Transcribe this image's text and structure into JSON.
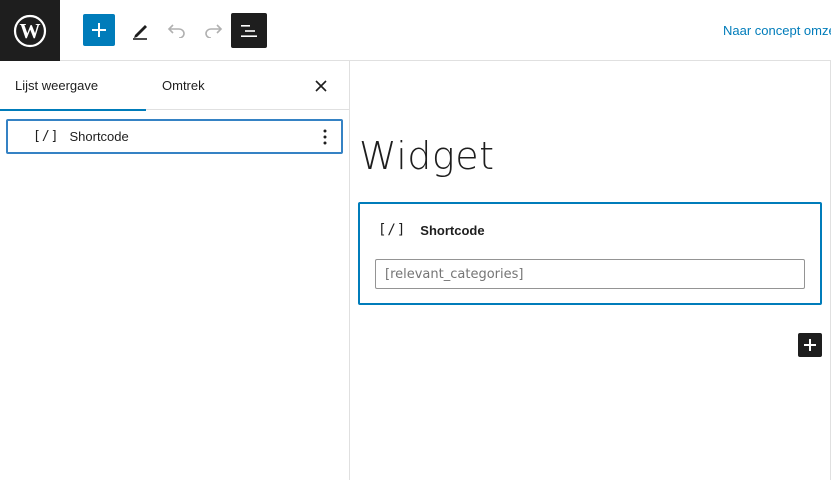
{
  "toolbar": {
    "logo_icon": "wordpress-icon",
    "add_icon": "plus-icon",
    "tools_icon": "pencil-icon",
    "undo_icon": "undo-icon",
    "redo_icon": "redo-icon",
    "list_view_icon": "list-view-icon",
    "draft_link": "Naar concept omze"
  },
  "sidebar": {
    "tabs": [
      {
        "label": "Lijst weergave",
        "active": true
      },
      {
        "label": "Omtrek",
        "active": false
      }
    ],
    "close_icon": "close-icon",
    "items": [
      {
        "icon": "[/]",
        "label": "Shortcode"
      }
    ]
  },
  "editor": {
    "title": "Widget",
    "block": {
      "icon": "[/]",
      "label": "Shortcode",
      "value": "[relevant_categories]"
    }
  },
  "colors": {
    "accent": "#007cba",
    "dark": "#1e1e1e",
    "border": "#e0e0e0"
  }
}
